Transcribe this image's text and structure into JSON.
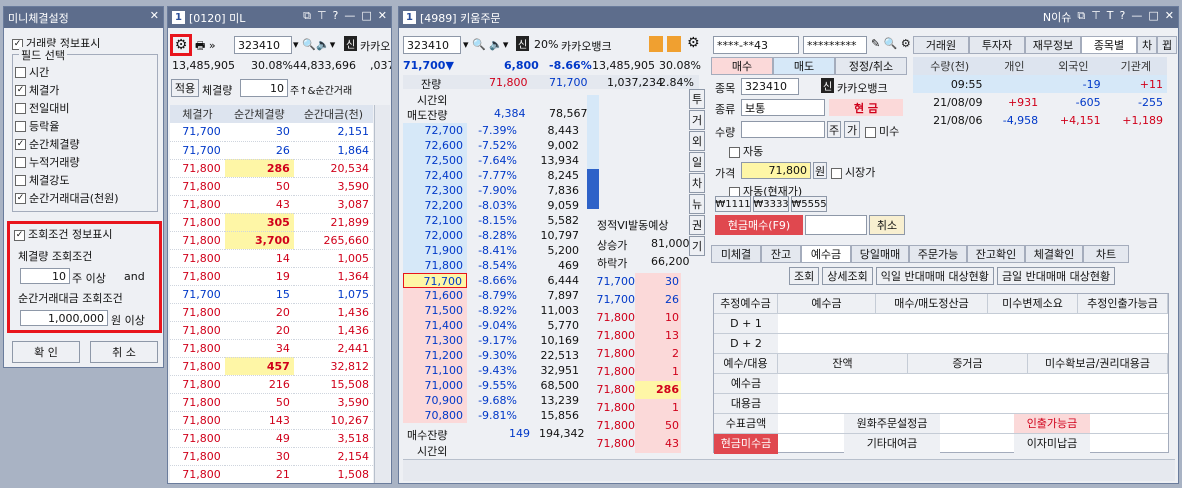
{
  "mini": {
    "title": "미니체결설정",
    "volume_display": "거래량 정보표시",
    "field_group": "필드 선택",
    "fields": [
      {
        "label": "시간",
        "checked": false
      },
      {
        "label": "체결가",
        "checked": true
      },
      {
        "label": "전일대비",
        "checked": false
      },
      {
        "label": "등락율",
        "checked": false
      },
      {
        "label": "순간체결량",
        "checked": true
      },
      {
        "label": "누적거래량",
        "checked": false
      },
      {
        "label": "체결강도",
        "checked": false
      },
      {
        "label": "순간거래대금(천원)",
        "checked": true
      }
    ],
    "cond_display": "조회조건 정보표시",
    "vol_cond_label": "체결량 조회조건",
    "vol_cond_value": "10",
    "vol_cond_unit": "주 이상",
    "and": "and",
    "amt_cond_label": "순간거래대금 조회조건",
    "amt_cond_value": "1,000,000",
    "amt_cond_unit": "원 이상",
    "ok": "확 인",
    "cancel": "취 소"
  },
  "w0120": {
    "title": "[0120] 미L",
    "code": "323410",
    "name": "카카오",
    "price": "13,485,905",
    "rate": "30.08%",
    "vol": "44,833,696",
    "vol2": ",037",
    "apply": "적용",
    "filter_label": "체결량",
    "filter_value": "10",
    "filter_unit": "주↑&순간거래",
    "cols": [
      "체결가",
      "순간체결량",
      "순간대금(천)"
    ],
    "rows": [
      [
        "71,700",
        "30",
        "2,151",
        "b",
        false
      ],
      [
        "71,700",
        "26",
        "1,864",
        "b",
        false
      ],
      [
        "71,800",
        "286",
        "20,534",
        "r",
        true
      ],
      [
        "71,800",
        "50",
        "3,590",
        "r",
        false
      ],
      [
        "71,800",
        "43",
        "3,087",
        "r",
        false
      ],
      [
        "71,800",
        "305",
        "21,899",
        "r",
        true
      ],
      [
        "71,800",
        "3,700",
        "265,660",
        "r",
        true
      ],
      [
        "71,800",
        "14",
        "1,005",
        "r",
        false
      ],
      [
        "71,800",
        "19",
        "1,364",
        "r",
        false
      ],
      [
        "71,700",
        "15",
        "1,075",
        "b",
        false
      ],
      [
        "71,800",
        "20",
        "1,436",
        "r",
        false
      ],
      [
        "71,800",
        "20",
        "1,436",
        "r",
        false
      ],
      [
        "71,800",
        "34",
        "2,441",
        "r",
        false
      ],
      [
        "71,800",
        "457",
        "32,812",
        "r",
        true
      ],
      [
        "71,800",
        "216",
        "15,508",
        "r",
        false
      ],
      [
        "71,800",
        "50",
        "3,590",
        "r",
        false
      ],
      [
        "71,800",
        "143",
        "10,267",
        "r",
        false
      ],
      [
        "71,800",
        "49",
        "3,518",
        "r",
        false
      ],
      [
        "71,800",
        "30",
        "2,154",
        "r",
        false
      ],
      [
        "71,800",
        "21",
        "1,508",
        "r",
        false
      ]
    ]
  },
  "w4989": {
    "title": "[4989] 키움주문",
    "right_title": "N이슈",
    "code": "323410",
    "pct": "20%",
    "name": "카카오뱅크",
    "acct": "****-**43",
    "pwd": "*********",
    "price": "71,700▼",
    "chg": "6,800",
    "chg_rate": "-8.66%",
    "vol": "13,485,905",
    "vol_rate": "30.08%",
    "rem_label": "잔량",
    "rem1": "71,800",
    "rem2": "71,700",
    "rem_vol": "1,037,234",
    "rem_rate": "2.84%",
    "ext_label": "시간외",
    "sell_rem": "매도잔량",
    "sell_rem_val": "4,384",
    "sell_rem_val2": "78,567",
    "asks": [
      [
        "72,700",
        "-7.39%",
        "8,443"
      ],
      [
        "72,600",
        "-7.52%",
        "9,002"
      ],
      [
        "72,500",
        "-7.64%",
        "13,934"
      ],
      [
        "72,400",
        "-7.77%",
        "8,245"
      ],
      [
        "72,300",
        "-7.90%",
        "7,836"
      ],
      [
        "72,200",
        "-8.03%",
        "9,059"
      ],
      [
        "72,100",
        "-8.15%",
        "5,582"
      ],
      [
        "72,000",
        "-8.28%",
        "10,797"
      ],
      [
        "71,900",
        "-8.41%",
        "5,200"
      ],
      [
        "71,800",
        "-8.54%",
        "469"
      ]
    ],
    "bids": [
      [
        "71,700",
        "-8.66%",
        "6,444"
      ],
      [
        "71,600",
        "-8.79%",
        "7,897"
      ],
      [
        "71,500",
        "-8.92%",
        "11,003"
      ],
      [
        "71,400",
        "-9.04%",
        "5,770"
      ],
      [
        "71,300",
        "-9.17%",
        "10,169"
      ],
      [
        "71,200",
        "-9.30%",
        "22,513"
      ],
      [
        "71,100",
        "-9.43%",
        "32,951"
      ],
      [
        "71,000",
        "-9.55%",
        "68,500"
      ],
      [
        "70,900",
        "-9.68%",
        "13,239"
      ],
      [
        "70,800",
        "-9.81%",
        "15,856"
      ]
    ],
    "buy_rem": "매수잔량",
    "buy_rem_val": "149",
    "buy_rem_val2": "194,342",
    "ext2": "시간외",
    "vi": "정적VI발동예상",
    "up": "상승가",
    "up_val": "81,000",
    "down": "하락가",
    "down_val": "66,200",
    "side_tabs": [
      "투",
      "거",
      "외",
      "일",
      "차",
      "뉴",
      "권",
      "기"
    ],
    "trades": [
      [
        "71,700",
        "30",
        "b",
        false
      ],
      [
        "71,700",
        "26",
        "b",
        false
      ],
      [
        "71,800",
        "10",
        "r",
        false
      ],
      [
        "71,800",
        "13",
        "r",
        false
      ],
      [
        "71,800",
        "2",
        "r",
        false
      ],
      [
        "71,800",
        "1",
        "r",
        false
      ],
      [
        "71,800",
        "286",
        "r",
        true
      ],
      [
        "71,800",
        "1",
        "r",
        false
      ],
      [
        "71,800",
        "50",
        "r",
        false
      ],
      [
        "71,800",
        "43",
        "r",
        false
      ]
    ],
    "order_tabs": [
      "매수",
      "매도",
      "정정/취소"
    ],
    "f_code_label": "종목",
    "f_code": "323410",
    "f_name": "카카오뱅크",
    "f_kind_label": "종류",
    "f_kind": "보통",
    "cash": "현 금",
    "f_qty_label": "수량",
    "ju": "주",
    "ga": "가",
    "misu": "미수",
    "auto": "자동",
    "f_price_label": "가격",
    "f_price": "71,800",
    "won": "원",
    "market": "시장가",
    "auto_cur": "자동(현재가)",
    "q1": "₩1111",
    "q2": "₩3333",
    "q3": "₩5555",
    "buy_btn": "현금매수(F9)",
    "cancel_btn": "취소",
    "inv_tabs": [
      "거래원",
      "투자자",
      "재무정보",
      "종목별",
      "차",
      "뀝"
    ],
    "inv_cols": [
      "수량(천)",
      "개인",
      "외국인",
      "기관계"
    ],
    "inv_rows": [
      [
        "09:55",
        "",
        "-19",
        "+11"
      ],
      [
        "21/08/09",
        "+931",
        "-605",
        "-255"
      ],
      [
        "21/08/06",
        "-4,958",
        "+4,151",
        "+1,189"
      ]
    ],
    "bottom_tabs": [
      "미체결",
      "잔고",
      "예수금",
      "당일매매",
      "주문가능",
      "잔고확인",
      "체결확인",
      "차트"
    ],
    "b_btns": [
      "조회",
      "상세조회",
      "익일 반대매매 대상현황",
      "금일 반대매매 대상현황"
    ],
    "dep_head": [
      "추정예수금",
      "예수금",
      "매수/매도정산금",
      "미수변제소요",
      "추정인출가능금"
    ],
    "d1": "D + 1",
    "d2": "D + 2",
    "sub_head": [
      "예수/대용",
      "잔액",
      "증거금",
      "미수확보금/권리대용금"
    ],
    "dep": "예수금",
    "sub": "대용금",
    "fee": "수표금액",
    "fx": "원화주문설정금",
    "withdraw": "인출가능금",
    "cash_misu": "현금미수금",
    "other": "기타대여금",
    "interest": "이자미납금"
  }
}
